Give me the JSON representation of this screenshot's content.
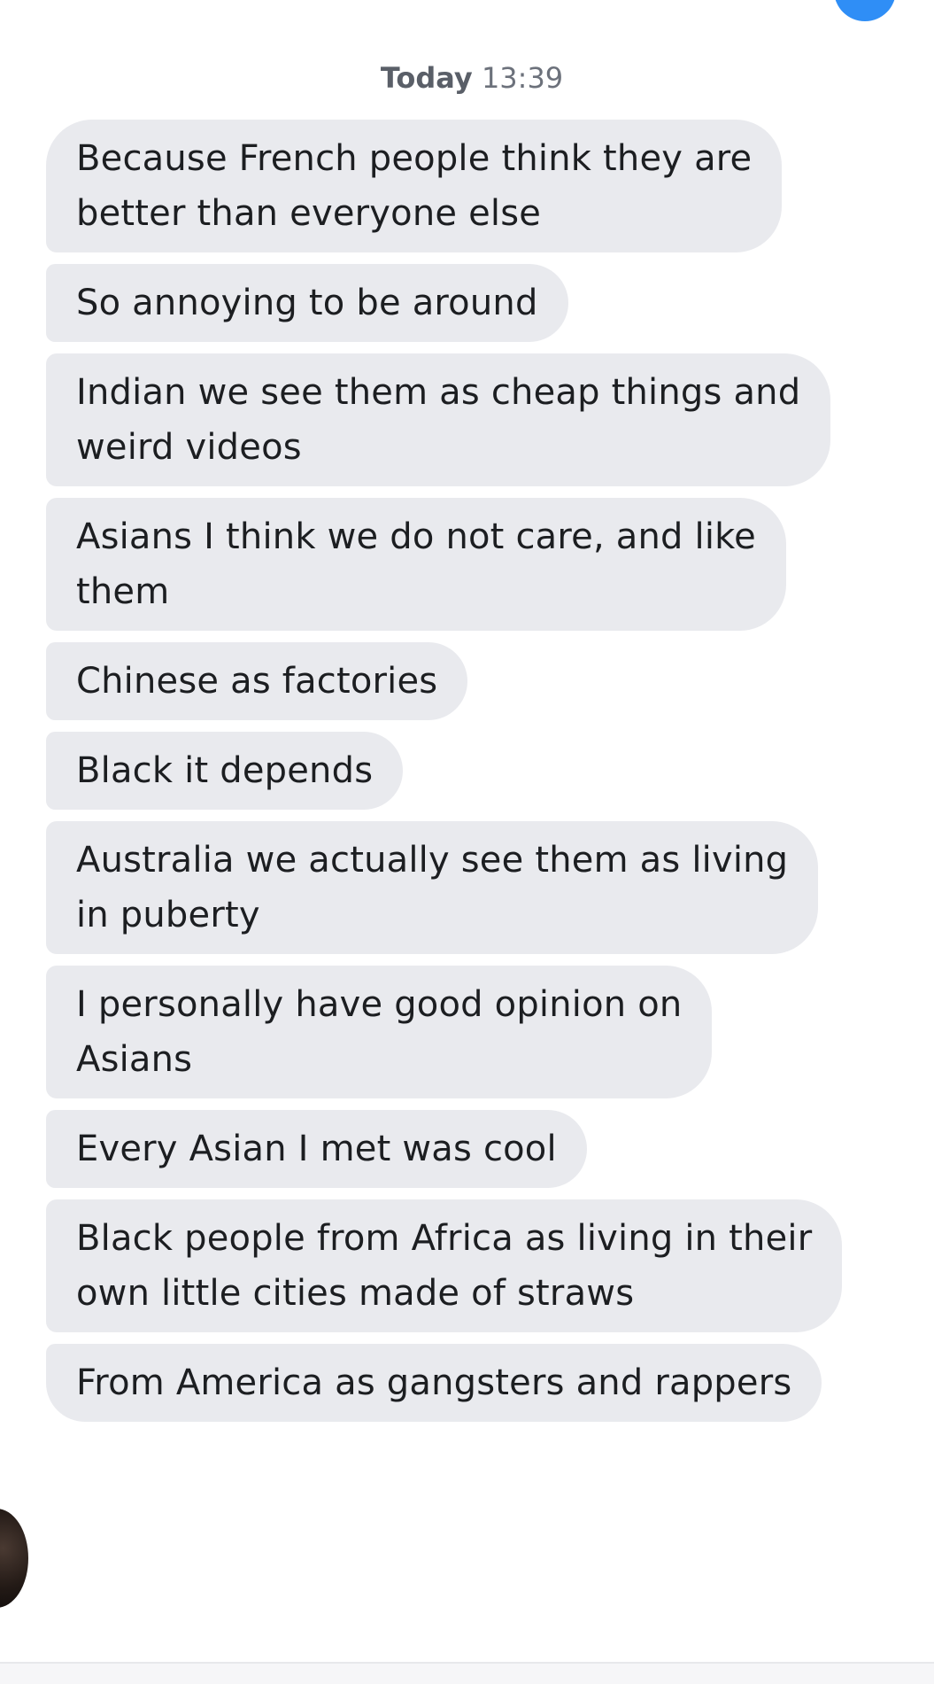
{
  "timestamp": {
    "day": "Today",
    "time": "13:39"
  },
  "messages": [
    {
      "line1": "Because French people think they are",
      "line2": "better than everyone else"
    },
    {
      "line1": "So annoying to be around"
    },
    {
      "line1": "Indian we see them as cheap things and",
      "line2": "weird videos"
    },
    {
      "line1": "Asians I think we do not care, and like",
      "line2": "them"
    },
    {
      "line1": "Chinese as factories"
    },
    {
      "line1": "Black it depends"
    },
    {
      "line1": "Australia we actually see them as living",
      "line2": "in puberty"
    },
    {
      "line1": "I personally have good opinion on",
      "line2": "Asians"
    },
    {
      "line1": "Every Asian I met was cool"
    },
    {
      "line1": "Black people from Africa as living in their",
      "line2": "own little cities made of straws"
    },
    {
      "line1": "From America as gangsters and rappers"
    }
  ],
  "colors": {
    "bubble": "#e9eaee",
    "accent": "#2f8ef6",
    "text": "#1c1e21"
  }
}
